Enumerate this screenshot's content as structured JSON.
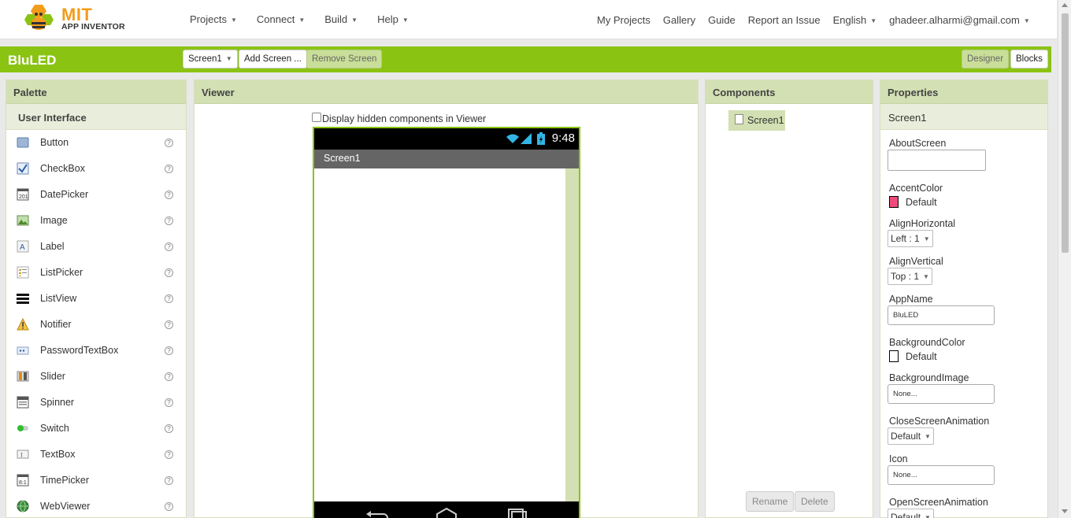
{
  "header": {
    "logo_title": "MIT",
    "logo_subtitle": "APP INVENTOR",
    "nav_left": [
      {
        "label": "Projects"
      },
      {
        "label": "Connect"
      },
      {
        "label": "Build"
      },
      {
        "label": "Help"
      }
    ],
    "nav_right": {
      "my_projects": "My Projects",
      "gallery": "Gallery",
      "guide": "Guide",
      "report": "Report an Issue",
      "language": "English",
      "user": "ghadeer.alharmi@gmail.com"
    }
  },
  "project_bar": {
    "name": "BluLED",
    "screen_select": "Screen1",
    "add_screen": "Add Screen ...",
    "remove_screen": "Remove Screen",
    "designer": "Designer",
    "blocks": "Blocks"
  },
  "palette": {
    "title": "Palette",
    "category": "User Interface",
    "help_glyph": "?",
    "items": [
      {
        "label": "Button",
        "icon": "button-icon"
      },
      {
        "label": "CheckBox",
        "icon": "checkbox-icon"
      },
      {
        "label": "DatePicker",
        "icon": "datepicker-icon"
      },
      {
        "label": "Image",
        "icon": "image-icon"
      },
      {
        "label": "Label",
        "icon": "label-icon"
      },
      {
        "label": "ListPicker",
        "icon": "listpicker-icon"
      },
      {
        "label": "ListView",
        "icon": "listview-icon"
      },
      {
        "label": "Notifier",
        "icon": "notifier-icon"
      },
      {
        "label": "PasswordTextBox",
        "icon": "passwordtextbox-icon"
      },
      {
        "label": "Slider",
        "icon": "slider-icon"
      },
      {
        "label": "Spinner",
        "icon": "spinner-icon"
      },
      {
        "label": "Switch",
        "icon": "switch-icon"
      },
      {
        "label": "TextBox",
        "icon": "textbox-icon"
      },
      {
        "label": "TimePicker",
        "icon": "timepicker-icon"
      },
      {
        "label": "WebViewer",
        "icon": "webviewer-icon"
      }
    ]
  },
  "viewer": {
    "title": "Viewer",
    "hidden_checkbox_label": "Display hidden components in Viewer",
    "status_time": "9:48",
    "screen_title": "Screen1"
  },
  "components": {
    "title": "Components",
    "root": "Screen1",
    "rename": "Rename",
    "delete": "Delete"
  },
  "properties": {
    "title": "Properties",
    "component": "Screen1",
    "about_screen_label": "AboutScreen",
    "accent_color_label": "AccentColor",
    "accent_color_value": "Default",
    "accent_color_hex": "#ee4b7b",
    "align_horizontal_label": "AlignHorizontal",
    "align_horizontal_value": "Left : 1",
    "align_vertical_label": "AlignVertical",
    "align_vertical_value": "Top : 1",
    "app_name_label": "AppName",
    "app_name_value": "BluLED",
    "background_color_label": "BackgroundColor",
    "background_color_value": "Default",
    "background_color_hex": "#ffffff",
    "background_image_label": "BackgroundImage",
    "background_image_value": "None...",
    "close_anim_label": "CloseScreenAnimation",
    "close_anim_value": "Default",
    "icon_label": "Icon",
    "icon_value": "None...",
    "open_anim_label": "OpenScreenAnimation",
    "open_anim_value": "Default"
  },
  "colors": {
    "brand_green": "#8bc313",
    "panel_header": "#d3e0b3",
    "logo_orange": "#f29c1c"
  }
}
